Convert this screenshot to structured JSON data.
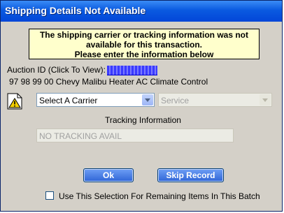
{
  "window": {
    "title": "Shipping Details Not Available"
  },
  "notice": {
    "line1": "The shipping carrier or tracking information was not",
    "line2": "available for this transaction.",
    "line3": "Please enter the information below"
  },
  "auction": {
    "label": "Auction ID (Click To View):",
    "item_description": "97 98 99 00 Chevy Malibu Heater AC Climate Control"
  },
  "carrier_select": {
    "value": "Select A Carrier"
  },
  "service_select": {
    "value": "Service"
  },
  "tracking": {
    "label": "Tracking Information",
    "value": "NO TRACKING AVAIL"
  },
  "buttons": {
    "ok": "Ok",
    "skip": "Skip Record"
  },
  "batch_checkbox": {
    "label": "Use This Selection For Remaining Items In This Batch",
    "checked": false
  },
  "icons": {
    "warning": "warning-document-icon",
    "dropdown": "chevron-down-icon"
  },
  "colors": {
    "titlebar": "#0a5ae0",
    "notice_bg": "#ffffcc",
    "link": "#0000cc"
  }
}
